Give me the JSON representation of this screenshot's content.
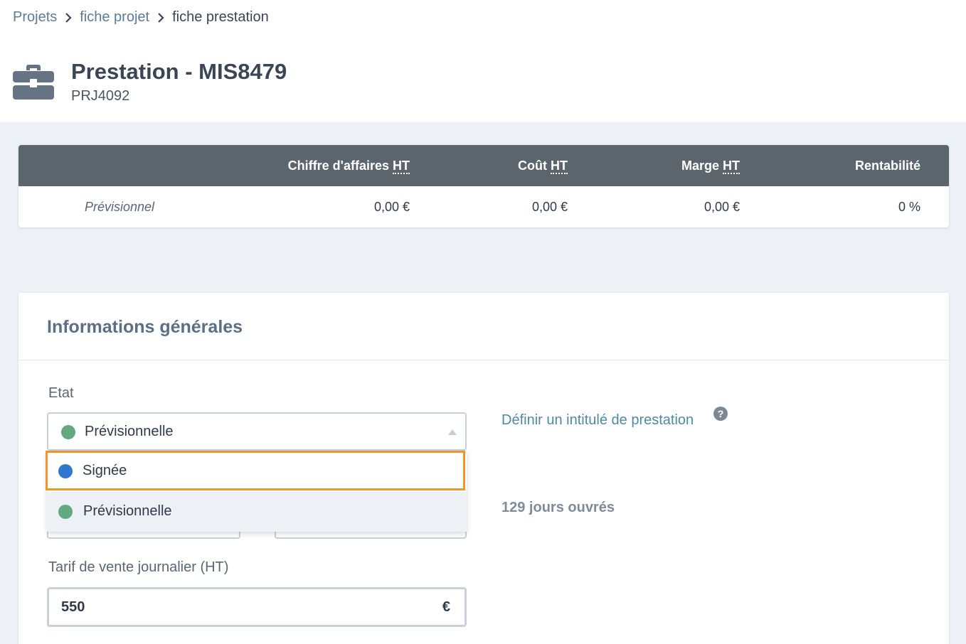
{
  "breadcrumb": {
    "items": [
      "Projets",
      "fiche projet",
      "fiche prestation"
    ]
  },
  "header": {
    "title": "Prestation - MIS8479",
    "subtitle": "PRJ4092",
    "icon": "briefcase-icon"
  },
  "financials": {
    "columns": [
      {
        "text": "Chiffre d'affaires ",
        "abbr": "HT"
      },
      {
        "text": "Coût ",
        "abbr": "HT"
      },
      {
        "text": "Marge ",
        "abbr": "HT"
      },
      {
        "text": "Rentabilité",
        "abbr": ""
      }
    ],
    "row": {
      "label": "Prévisionnel",
      "values": [
        "0,00 €",
        "0,00 €",
        "0,00 €",
        "0 %"
      ]
    }
  },
  "info": {
    "title": "Informations générales",
    "etat_label": "Etat",
    "etat_selected": "Prévisionnelle",
    "options": [
      {
        "label": "Signée",
        "color": "#2f77d0"
      },
      {
        "label": "Prévisionnelle",
        "color": "#62a882"
      }
    ],
    "define_link": "Définir un intitulé de prestation",
    "help_glyph": "?",
    "working_days": "129 jours ouvrés",
    "tarif_label": "Tarif de vente journalier (HT)",
    "tarif_value": "550",
    "tarif_currency": "€"
  },
  "colors": {
    "header_bar": "#5c646c",
    "highlight": "#f0952a",
    "link": "#4d8aa6",
    "signee": "#2f77d0",
    "previsionnelle": "#62a882"
  }
}
